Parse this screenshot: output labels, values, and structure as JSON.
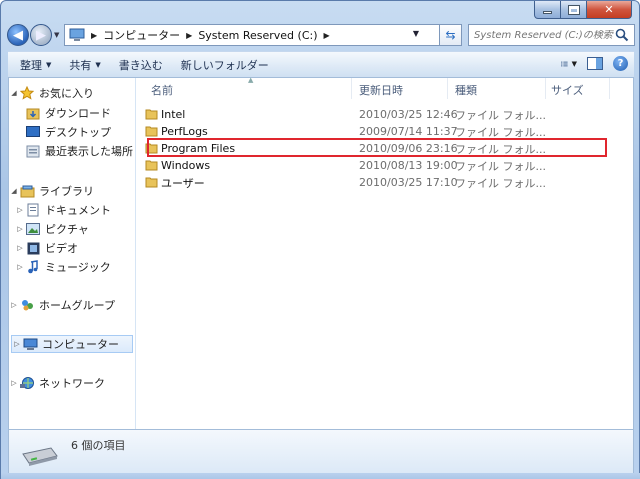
{
  "window": {
    "caption_buttons": {
      "minimize": "minimize-icon",
      "maximize": "maximize-icon",
      "close": "✕"
    }
  },
  "address_bar": {
    "crumbs": [
      "コンピューター",
      "System Reserved (C:)"
    ],
    "search_placeholder": "System Reserved (C:)の検索"
  },
  "toolbar": {
    "organize": "整理",
    "share": "共有",
    "burn": "書き込む",
    "new_folder": "新しいフォルダー"
  },
  "nav_pane": {
    "favorites": "お気に入り",
    "downloads": "ダウンロード",
    "desktop": "デスクトップ",
    "recent": "最近表示した場所",
    "libraries": "ライブラリ",
    "documents": "ドキュメント",
    "pictures": "ピクチャ",
    "videos": "ビデオ",
    "music": "ミュージック",
    "homegroup": "ホームグループ",
    "computer": "コンピューター",
    "network": "ネットワーク"
  },
  "columns": {
    "name": "名前",
    "modified": "更新日時",
    "type": "種類",
    "size": "サイズ"
  },
  "files": [
    {
      "name": "Intel",
      "date": "2010/03/25 12:46",
      "type": "ファイル フォル..."
    },
    {
      "name": "PerfLogs",
      "date": "2009/07/14 11:37",
      "type": "ファイル フォル..."
    },
    {
      "name": "Program Files",
      "date": "2010/09/06 23:16",
      "type": "ファイル フォル..."
    },
    {
      "name": "Windows",
      "date": "2010/08/13 19:00",
      "type": "ファイル フォル..."
    },
    {
      "name": "ユーザー",
      "date": "2010/03/25 17:10",
      "type": "ファイル フォル..."
    }
  ],
  "status": {
    "item_count": "6 個の項目"
  },
  "colors": {
    "highlight_box": "#e0262e",
    "folder": "#e8c35a"
  }
}
